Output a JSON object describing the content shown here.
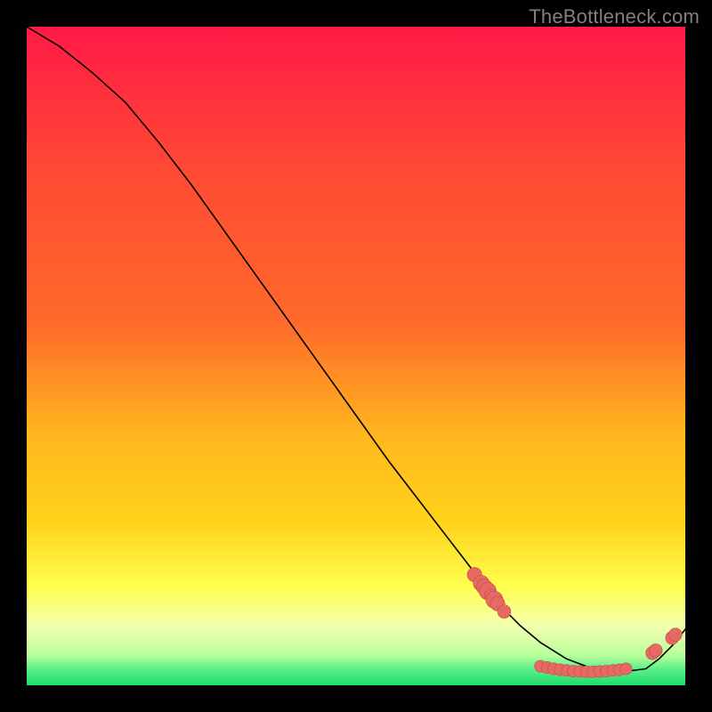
{
  "watermark": "TheBottleneck.com",
  "colors": {
    "black": "#000000",
    "gradient_top": "#ff1a45",
    "gradient_upper": "#ff6a2a",
    "gradient_mid": "#ffd21a",
    "gradient_yellow": "#ffff4d",
    "gradient_pale": "#f4ffb0",
    "gradient_green": "#1fdb6b",
    "curve": "#000000",
    "marker_fill": "#e46a63",
    "marker_stroke": "#c94a46"
  },
  "chart_data": {
    "type": "line",
    "title": "",
    "xlabel": "",
    "ylabel": "",
    "xlim": [
      0,
      100
    ],
    "ylim": [
      0,
      100
    ],
    "curve": {
      "x": [
        0,
        5,
        10,
        15,
        20,
        25,
        30,
        35,
        40,
        45,
        50,
        55,
        60,
        65,
        70,
        72,
        75,
        78,
        82,
        86,
        90,
        94,
        96,
        98,
        100
      ],
      "y": [
        100,
        97,
        93,
        88.5,
        82.5,
        76,
        69,
        62,
        55,
        48,
        41,
        34,
        27.5,
        21,
        14.5,
        12,
        9,
        6.5,
        4,
        2.5,
        2,
        2.5,
        4,
        6,
        8.5
      ]
    },
    "markers": [
      {
        "x": 68,
        "y": 16.8,
        "r": 1.1
      },
      {
        "x": 69,
        "y": 15.5,
        "r": 1.2
      },
      {
        "x": 69.5,
        "y": 14.9,
        "r": 1.2
      },
      {
        "x": 70,
        "y": 14.3,
        "r": 1.3
      },
      {
        "x": 70.5,
        "y": 13.6,
        "r": 1.0
      },
      {
        "x": 71,
        "y": 13.0,
        "r": 1.3
      },
      {
        "x": 71.5,
        "y": 12.4,
        "r": 1.1
      },
      {
        "x": 72.5,
        "y": 11.2,
        "r": 1.0
      },
      {
        "x": 78,
        "y": 2.9,
        "r": 0.9
      },
      {
        "x": 79,
        "y": 2.7,
        "r": 0.9
      },
      {
        "x": 80,
        "y": 2.5,
        "r": 0.9
      },
      {
        "x": 81,
        "y": 2.35,
        "r": 0.9
      },
      {
        "x": 82,
        "y": 2.25,
        "r": 0.9
      },
      {
        "x": 83,
        "y": 2.15,
        "r": 0.9
      },
      {
        "x": 84,
        "y": 2.1,
        "r": 0.9
      },
      {
        "x": 85,
        "y": 2.05,
        "r": 0.9
      },
      {
        "x": 86,
        "y": 2.05,
        "r": 0.9
      },
      {
        "x": 87,
        "y": 2.1,
        "r": 0.9
      },
      {
        "x": 88,
        "y": 2.15,
        "r": 0.9
      },
      {
        "x": 89,
        "y": 2.25,
        "r": 0.9
      },
      {
        "x": 90,
        "y": 2.35,
        "r": 0.9
      },
      {
        "x": 91,
        "y": 2.5,
        "r": 0.9
      },
      {
        "x": 95,
        "y": 4.9,
        "r": 1.0
      },
      {
        "x": 95.5,
        "y": 5.3,
        "r": 1.0
      },
      {
        "x": 98,
        "y": 7.2,
        "r": 1.0
      },
      {
        "x": 98.5,
        "y": 7.7,
        "r": 1.0
      }
    ],
    "marker_label": {
      "text": "",
      "x": 84,
      "y": 3.6
    }
  }
}
